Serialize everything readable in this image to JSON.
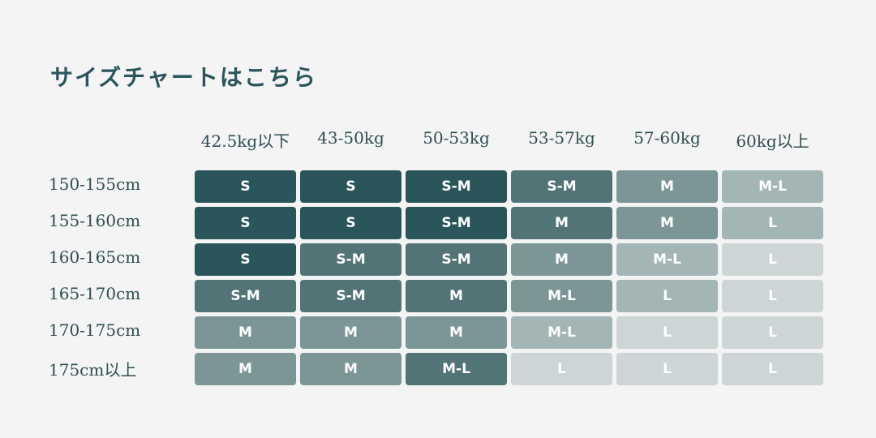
{
  "title": "サイズチャートはこちら",
  "colors": {
    "S": "#2a555b",
    "S-M": "#527477",
    "M": "#7c9698",
    "M-L": "#a4b5b6",
    "L": "#cdd5d6"
  },
  "chart_data": {
    "type": "table",
    "columns": [
      "42.5kg以下",
      "43-50kg",
      "50-53kg",
      "53-57kg",
      "57-60kg",
      "60kg以上"
    ],
    "rows": [
      "150-155cm",
      "155-160cm",
      "160-165cm",
      "165-170cm",
      "170-175cm",
      "175cm以上"
    ],
    "cells": [
      [
        "S",
        "S",
        "S-M",
        "S-M",
        "M",
        "M-L"
      ],
      [
        "S",
        "S",
        "S-M",
        "M",
        "M",
        "L"
      ],
      [
        "S",
        "S-M",
        "S-M",
        "M",
        "M-L",
        "L"
      ],
      [
        "S-M",
        "S-M",
        "M",
        "M-L",
        "L",
        "L"
      ],
      [
        "M",
        "M",
        "M",
        "M-L",
        "L",
        "L"
      ],
      [
        "M",
        "M",
        "M-L",
        "L",
        "L",
        "L"
      ]
    ],
    "cell_colors": [
      [
        "S",
        "S",
        "S",
        "S-M",
        "M",
        "M-L"
      ],
      [
        "S",
        "S",
        "S",
        "S-M",
        "M",
        "M-L"
      ],
      [
        "S",
        "S-M",
        "S-M",
        "M",
        "M-L",
        "L"
      ],
      [
        "S-M",
        "S-M",
        "S-M",
        "M",
        "M-L",
        "L"
      ],
      [
        "M",
        "M",
        "M",
        "M-L",
        "L",
        "L"
      ],
      [
        "M",
        "M",
        "S-M",
        "L",
        "L",
        "L"
      ]
    ]
  }
}
